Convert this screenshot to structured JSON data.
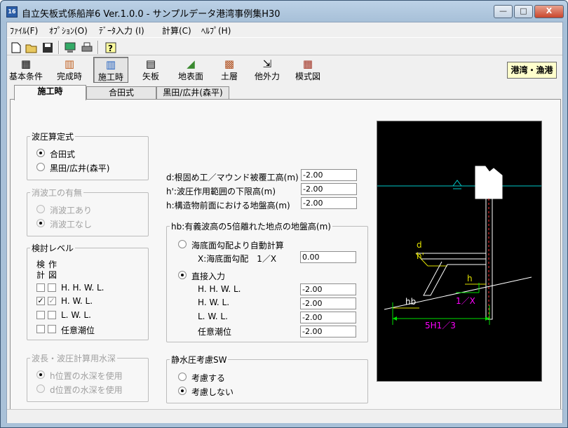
{
  "window": {
    "title": "自立矢板式係船岸6 Ver.1.0.0 - サンプルデータ港湾事例集H30",
    "app_icon": "16",
    "min_label": "—",
    "max_label": "□",
    "close_label": "X"
  },
  "menu": [
    "ﾌｧｲﾙ(F)",
    "ｵﾌﾟｼｮﾝ(O)",
    "ﾃﾞｰﾀ入力 (I)",
    "計算(C)",
    "ﾍﾙﾌﾟ(H)"
  ],
  "toolbar": {
    "icons": [
      "new-file-icon",
      "open-folder-icon",
      "save-icon",
      "monitor-icon",
      "print-icon",
      "help-icon"
    ]
  },
  "tabs_big": [
    "基本条件",
    "完成時",
    "施工時",
    "矢板",
    "地表面",
    "土層",
    "他外力",
    "模式図"
  ],
  "port_label": "港湾・漁港",
  "tabs": [
    "施工時",
    "合田式",
    "黒田/広井(森平)"
  ],
  "wave": {
    "legend": "波圧算定式",
    "opt1": "合田式",
    "opt2": "黒田/広井(森平)"
  },
  "absorb": {
    "legend": "消波工の有無",
    "opt1": "消波工あり",
    "opt2": "消波工なし"
  },
  "level": {
    "legend": "検討レベル",
    "h1a": "検",
    "h1b": "作",
    "h2a": "計",
    "h2b": "図",
    "rows": [
      "H. H. W. L.",
      "H. W. L.",
      "L. W. L.",
      "任意潮位"
    ]
  },
  "depth": {
    "legend": "波長・波圧計算用水深",
    "opt1": "h位置の水深を使用",
    "opt2": "d位置の水深を使用"
  },
  "params": {
    "d_label": "d:根固め工／マウンド被覆工高(m)",
    "d_val": "-2.00",
    "h_label": "h':波圧作用範囲の下限高(m)",
    "h_val": "-2.00",
    "g_label": "h:構造物前面における地盤高(m)",
    "g_val": "-2.00"
  },
  "hb": {
    "legend": "hb:有義波高の5倍離れた地点の地盤高(m)",
    "auto": "海底面勾配より自動計算",
    "x_label": "X:海底面勾配　1／X",
    "x_val": "0.00",
    "direct": "直接入力",
    "rows": [
      "H. H. W. L.",
      "H. W. L.",
      "L. W. L.",
      "任意潮位"
    ],
    "vals": [
      "-2.00",
      "-2.00",
      "-2.00",
      "-2.00"
    ]
  },
  "hydro": {
    "legend": "静水圧考慮SW",
    "opt1": "考慮する",
    "opt2": "考慮しない"
  },
  "diagram": {
    "d": "d",
    "hprime": "h'",
    "h": "h",
    "hb": "hb",
    "slope": "1／X",
    "dist": "5H1／3",
    "colors": {
      "water": "#00c8c8",
      "yellow": "#e0e000",
      "green": "#00e000",
      "magenta": "#ff00ff",
      "red": "#ff3030"
    }
  }
}
